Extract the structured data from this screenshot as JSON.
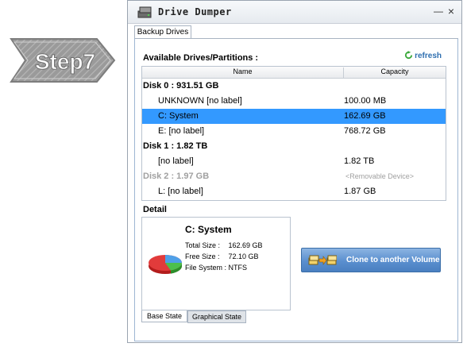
{
  "step_badge": {
    "label": "Step7"
  },
  "window": {
    "title": "Drive Dumper",
    "min_glyph": "—",
    "close_glyph": "×"
  },
  "tabs": {
    "backup_drives": "Backup Drives"
  },
  "drives_section": {
    "title": "Available Drives/Partitions :",
    "refresh_label": "refresh",
    "columns": {
      "name": "Name",
      "capacity": "Capacity"
    },
    "rows": [
      {
        "name": "Disk 0 :   931.51 GB",
        "capacity": ""
      },
      {
        "name": "UNKNOWN [no label]",
        "capacity": "100.00 MB"
      },
      {
        "name": "C: System",
        "capacity": "162.69 GB"
      },
      {
        "name": "E: [no label]",
        "capacity": "768.72 GB"
      },
      {
        "name": "Disk 1 :   1.82 TB",
        "capacity": ""
      },
      {
        "name": "[no label]",
        "capacity": "1.82 TB"
      },
      {
        "name": "Disk 2 :   1.97 GB",
        "capacity": "<Removable Device>"
      },
      {
        "name": "L: [no label]",
        "capacity": "1.87 GB"
      }
    ]
  },
  "detail": {
    "title": "Detail",
    "name": "C: System",
    "total_size_label": "Total Size :",
    "total_size": "162.69 GB",
    "free_size_label": "Free  Size  :",
    "free_size": "72.10 GB",
    "fs_label": "File System :",
    "fs": "NTFS",
    "tab_base": "Base State",
    "tab_graphical": "Graphical State"
  },
  "clone_button": {
    "label": "Clone to another Volume"
  },
  "colors": {
    "selection": "#3399ff",
    "accent": "#2f6fb0",
    "button": "#5a8fcf"
  }
}
